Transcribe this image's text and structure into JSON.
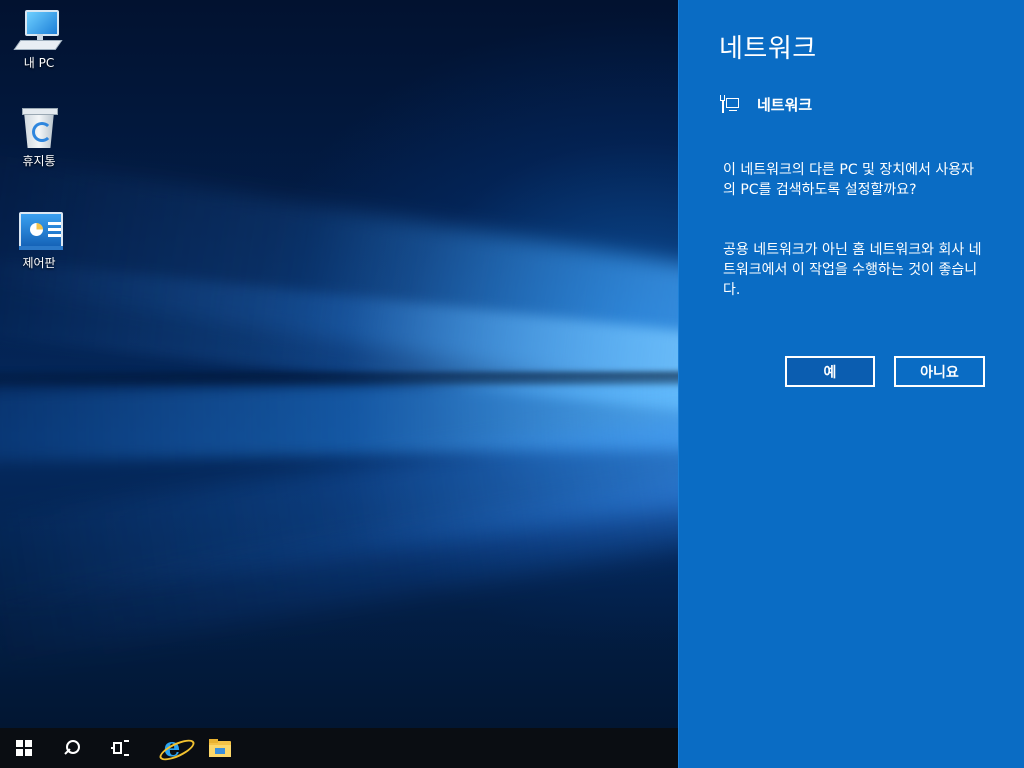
{
  "desktop": {
    "icons": [
      {
        "label": "내 PC",
        "icon": "computer-icon"
      },
      {
        "label": "휴지통",
        "icon": "recycle-bin-icon"
      },
      {
        "label": "제어판",
        "icon": "control-panel-icon"
      }
    ]
  },
  "taskbar": {
    "items": [
      "start-windows-icon",
      "search-icon",
      "task-view-icon",
      "internet-explorer-icon",
      "file-explorer-icon"
    ]
  },
  "network_flyout": {
    "title": "네트워크",
    "network_name": "네트워크",
    "network_icon": "wired-network-icon",
    "question": "이 네트워크의 다른 PC 및 장치에서 사용자의 PC를 검색하도록 설정할까요?",
    "advice": "공용 네트워크가 아닌 홈 네트워크와 회사 네트워크에서 이 작업을 수행하는 것이 좋습니다.",
    "yes_label": "예",
    "no_label": "아니요",
    "background_color": "#0a6cc4"
  }
}
